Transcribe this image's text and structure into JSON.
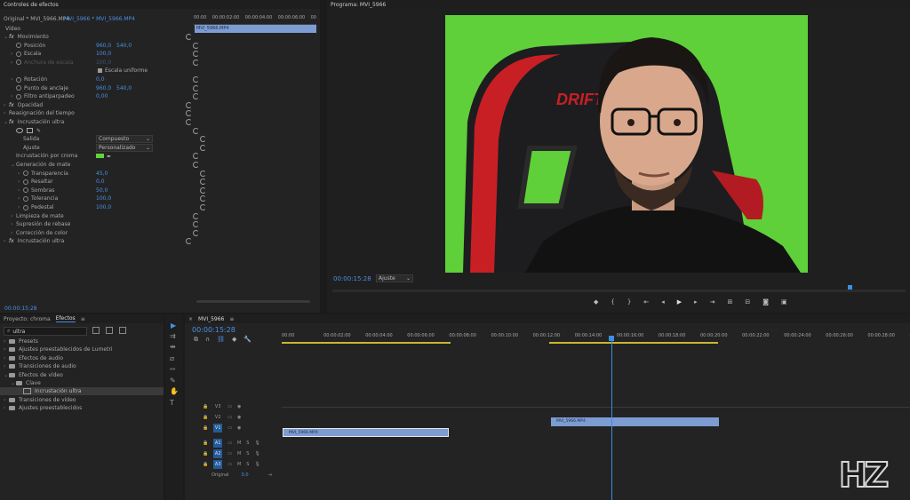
{
  "effect_controls": {
    "panel_title": "Controles de efectos",
    "source_tab": "Original * MVI_5966.MP4",
    "seq_tab": "MVI_5966 * MVI_5966.MP4",
    "mini_ruler": [
      "00:00",
      "00:00:02:00",
      "00:00:04:00",
      "00:00:06:00",
      "00"
    ],
    "mini_clip": "MVI_5966.MP4",
    "section": "Vídeo",
    "timecode": "00:00:15:28",
    "rows": [
      {
        "label": "Movimiento",
        "indent": 0,
        "fx": true,
        "twirl": "v"
      },
      {
        "label": "Posición",
        "indent": 2,
        "stop": true,
        "v1": "960,0",
        "v2": "540,0"
      },
      {
        "label": "Escala",
        "indent": 2,
        "stop": true,
        "twirl": ">",
        "v1": "100,0"
      },
      {
        "label": "Anchura de escala",
        "indent": 2,
        "stop": true,
        "twirl": ">",
        "v1": "100,0",
        "dim": true
      },
      {
        "label": "",
        "indent": 6,
        "check": "Escala uniforme"
      },
      {
        "label": "Rotación",
        "indent": 2,
        "stop": true,
        "twirl": ">",
        "v1": "0,0"
      },
      {
        "label": "Punto de anclaje",
        "indent": 2,
        "stop": true,
        "v1": "960,0",
        "v2": "540,0"
      },
      {
        "label": "Filtro antiparpadeo",
        "indent": 2,
        "stop": true,
        "twirl": ">",
        "v1": "0,00"
      },
      {
        "label": "Opacidad",
        "indent": 0,
        "fx": true,
        "twirl": ">"
      },
      {
        "label": "Reasignación del tiempo",
        "indent": 0,
        "twirl": ">"
      },
      {
        "label": "Incrustación ultra",
        "indent": 0,
        "fx": true,
        "twirl": "v"
      },
      {
        "label": "",
        "indent": 2,
        "shapes": true
      },
      {
        "label": "Salida",
        "indent": 4,
        "dd": "Compuesto"
      },
      {
        "label": "Ajuste",
        "indent": 4,
        "dd": "Personalizado"
      },
      {
        "label": "Incrustación por croma",
        "indent": 2,
        "swatch": true
      },
      {
        "label": "Generación de mate",
        "indent": 2,
        "twirl": "v"
      },
      {
        "label": "Transparencia",
        "indent": 4,
        "stop": true,
        "twirl": ">",
        "v1": "45,0"
      },
      {
        "label": "Resaltar",
        "indent": 4,
        "stop": true,
        "twirl": ">",
        "v1": "0,0"
      },
      {
        "label": "Sombras",
        "indent": 4,
        "stop": true,
        "twirl": ">",
        "v1": "50,0"
      },
      {
        "label": "Tolerancia",
        "indent": 4,
        "stop": true,
        "twirl": ">",
        "v1": "100,0"
      },
      {
        "label": "Pedestal",
        "indent": 4,
        "stop": true,
        "twirl": ">",
        "v1": "100,0"
      },
      {
        "label": "Limpieza de mate",
        "indent": 2,
        "twirl": ">"
      },
      {
        "label": "Supresión de rebase",
        "indent": 2,
        "twirl": ">"
      },
      {
        "label": "Corrección de color",
        "indent": 2,
        "twirl": ">"
      },
      {
        "label": "Incrustación ultra",
        "indent": 0,
        "fx": true,
        "twirl": ">"
      }
    ]
  },
  "program": {
    "title": "Programa: MVI_5966",
    "timecode": "00:00:15:28",
    "fit": "Ajuste",
    "chair_logo": "DRIFT"
  },
  "project": {
    "tab_project": "Proyecto: chroma",
    "tab_effects": "Efectos",
    "search_value": "ultra",
    "items": [
      {
        "label": "Presets",
        "indent": 0
      },
      {
        "label": "Ajustes preestablecidos de Lumetri",
        "indent": 0
      },
      {
        "label": "Efectos de audio",
        "indent": 0
      },
      {
        "label": "Transiciones de audio",
        "indent": 0
      },
      {
        "label": "Efectos de vídeo",
        "indent": 0,
        "open": true
      },
      {
        "label": "Clave",
        "indent": 1,
        "open": true
      },
      {
        "label": "Incrustación ultra",
        "indent": 2,
        "selected": true
      },
      {
        "label": "Transiciones de vídeo",
        "indent": 0
      },
      {
        "label": "Ajustes preestablecidos",
        "indent": 0
      }
    ]
  },
  "timeline": {
    "seq_tab": "MVI_5966",
    "timecode": "00:00:15:28",
    "ruler": [
      "00:00",
      "00:00:02:00",
      "00:00:04:00",
      "00:00:06:00",
      "00:00:08:00",
      "00:00:10:00",
      "00:00:12:00",
      "00:00:14:00",
      "00:00:16:00",
      "00:00:18:00",
      "00:00:20:00",
      "00:00:22:00",
      "00:00:24:00",
      "00:00:26:00",
      "00:00:28:00",
      "00:00"
    ],
    "video_tracks": [
      "V3",
      "V2",
      "V1"
    ],
    "audio_tracks": [
      "A1",
      "A2",
      "A3"
    ],
    "master_label": "Original",
    "master_value": "0,0",
    "clips": {
      "v1": "MVI_5966.MP4",
      "v2": "MVI_5966.MP4"
    }
  },
  "watermark": "HZ",
  "colors": {
    "accent": "#4a8fe3",
    "clip": "#7d9cd1",
    "playhead": "#3b8fe6",
    "green": "#61d33a"
  }
}
